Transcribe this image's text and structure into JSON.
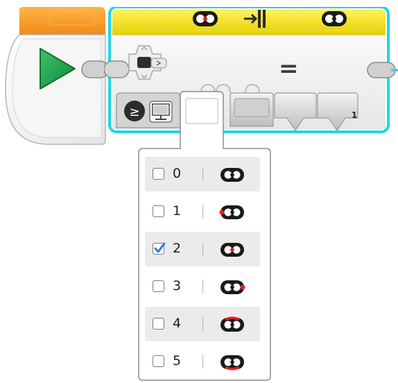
{
  "start_block": {
    "icon": "play-icon",
    "colors": {
      "accent": "#f39a1e",
      "play": "#1e9a43"
    }
  },
  "sensor_block": {
    "colors": {
      "header": "#e8d400",
      "outline": "#22d3e6"
    },
    "header_icons": [
      "sensor-icon",
      "port-icon",
      "equals-icon",
      "sensor-icon"
    ],
    "equals_symbol": "=",
    "threshold_value": "1",
    "mode_icons": [
      "compare-icon",
      "display-icon"
    ]
  },
  "port_selector": {
    "selected_value": "",
    "ports": [
      {
        "label": "0",
        "checked": false,
        "icon": "sensor-port-0-icon"
      },
      {
        "label": "1",
        "checked": false,
        "icon": "sensor-port-1-icon"
      },
      {
        "label": "2",
        "checked": true,
        "icon": "sensor-port-2-icon"
      },
      {
        "label": "3",
        "checked": false,
        "icon": "sensor-port-3-icon"
      },
      {
        "label": "4",
        "checked": false,
        "icon": "sensor-port-4-icon"
      },
      {
        "label": "5",
        "checked": false,
        "icon": "sensor-port-5-icon"
      }
    ],
    "colors": {
      "check": "#1f7ad6",
      "indicator": "#e02020"
    }
  }
}
